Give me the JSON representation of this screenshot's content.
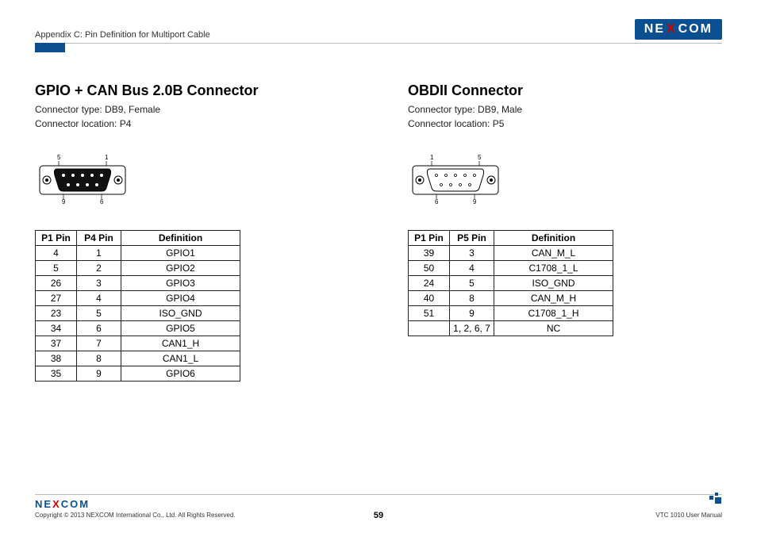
{
  "header": {
    "breadcrumb": "Appendix C: Pin Definition for Multiport Cable",
    "logo_parts": [
      "NE",
      "X",
      "COM"
    ]
  },
  "left": {
    "title": "GPIO + CAN Bus 2.0B Connector",
    "type_line": "Connector type: DB9, Female",
    "loc_line": "Connector location: P4",
    "svg_labels": {
      "tl": "5",
      "tr": "1",
      "bl": "9",
      "br": "6"
    },
    "table": {
      "headers": [
        "P1 Pin",
        "P4 Pin",
        "Definition"
      ],
      "rows": [
        [
          "4",
          "1",
          "GPIO1"
        ],
        [
          "5",
          "2",
          "GPIO2"
        ],
        [
          "26",
          "3",
          "GPIO3"
        ],
        [
          "27",
          "4",
          "GPIO4"
        ],
        [
          "23",
          "5",
          "ISO_GND"
        ],
        [
          "34",
          "6",
          "GPIO5"
        ],
        [
          "37",
          "7",
          "CAN1_H"
        ],
        [
          "38",
          "8",
          "CAN1_L"
        ],
        [
          "35",
          "9",
          "GPIO6"
        ]
      ]
    }
  },
  "right": {
    "title": "OBDII Connector",
    "type_line": "Connector type: DB9, Male",
    "loc_line": "Connector location: P5",
    "svg_labels": {
      "tl": "1",
      "tr": "5",
      "bl": "6",
      "br": "9"
    },
    "table": {
      "headers": [
        "P1 Pin",
        "P5 Pin",
        "Definition"
      ],
      "rows": [
        [
          "39",
          "3",
          "CAN_M_L"
        ],
        [
          "50",
          "4",
          "C1708_1_L"
        ],
        [
          "24",
          "5",
          "ISO_GND"
        ],
        [
          "40",
          "8",
          "CAN_M_H"
        ],
        [
          "51",
          "9",
          "C1708_1_H"
        ],
        [
          "",
          "1, 2, 6, 7",
          "NC"
        ]
      ]
    }
  },
  "footer": {
    "copyright": "Copyright © 2013 NEXCOM International Co., Ltd. All Rights Reserved.",
    "page": "59",
    "manual": "VTC 1010 User Manual"
  }
}
